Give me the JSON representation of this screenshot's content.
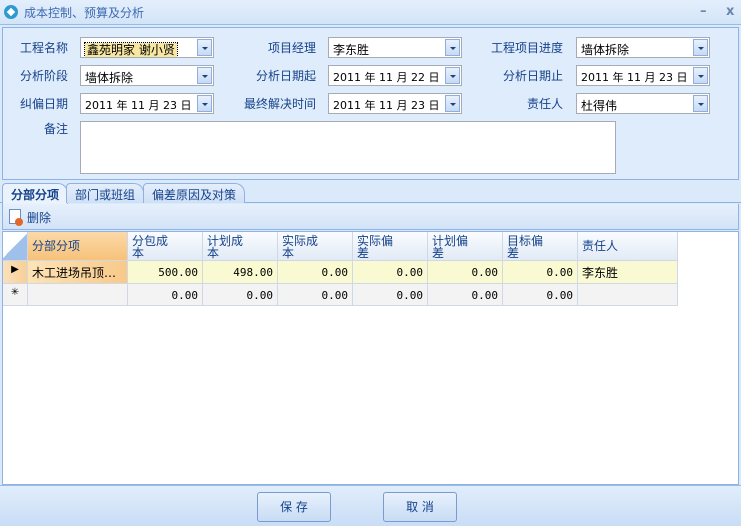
{
  "window": {
    "title": "成本控制、预算及分析",
    "minimize": "–",
    "close": "x"
  },
  "form": {
    "project_name": {
      "label": "工程名称",
      "value": "鑫苑明家 谢小贤"
    },
    "project_manager": {
      "label": "项目经理",
      "value": "李东胜"
    },
    "project_progress": {
      "label": "工程项目进度",
      "value": "墙体拆除"
    },
    "analysis_stage": {
      "label": "分析阶段",
      "value": "墙体拆除"
    },
    "analysis_date_start": {
      "label": "分析日期起",
      "value": "2011 年 11 月 22 日"
    },
    "analysis_date_end": {
      "label": "分析日期止",
      "value": "2011 年 11 月 23 日"
    },
    "correction_date": {
      "label": "纠偏日期",
      "value": "2011 年 11 月 23 日"
    },
    "final_resolution_time": {
      "label": "最终解决时间",
      "value": "2011 年 11 月 23 日"
    },
    "responsible": {
      "label": "责任人",
      "value": "杜得伟"
    },
    "notes": {
      "label": "备注",
      "value": ""
    }
  },
  "tabs": [
    {
      "label": "分部分项",
      "active": true
    },
    {
      "label": "部门或班组"
    },
    {
      "label": "偏差原因及对策"
    }
  ],
  "toolbar": {
    "delete_label": "删除"
  },
  "grid": {
    "columns": [
      "分部分项",
      "分包成\n本",
      "计划成\n本",
      "实际成\n本",
      "实际偏\n差",
      "计划偏\n差",
      "目标偏\n差",
      "责任人"
    ],
    "rows": [
      {
        "marker": "▶",
        "cells": [
          "木工进场吊顶…",
          "500.00",
          "498.00",
          "0.00",
          "0.00",
          "0.00",
          "0.00",
          "李东胜"
        ]
      },
      {
        "marker": "✳",
        "cells": [
          "",
          "0.00",
          "0.00",
          "0.00",
          "0.00",
          "0.00",
          "0.00",
          ""
        ]
      }
    ]
  },
  "footer": {
    "save": "保 存",
    "cancel": "取 消"
  }
}
